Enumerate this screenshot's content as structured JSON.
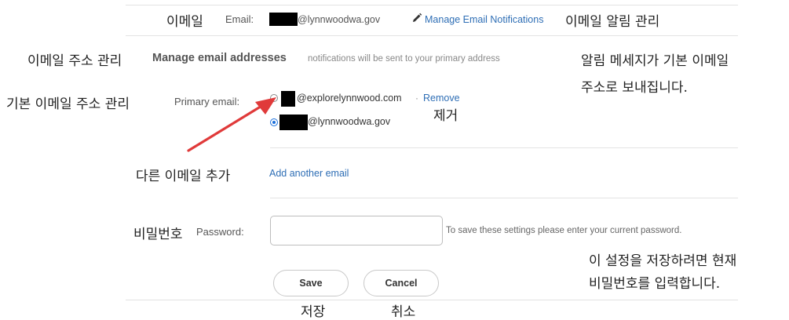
{
  "email_row": {
    "korean_label": "이메일",
    "label": "Email:",
    "value": "@lynnwoodwa.gov",
    "manage_link": "Manage Email Notifications",
    "manage_korean": "이메일 알림 관리"
  },
  "manage_section": {
    "korean_title": "이메일 주소 관리",
    "title": "Manage email addresses",
    "note": "notifications will be sent to your primary address",
    "note_korean_line1": "알림 메세지가 기본 이메일",
    "note_korean_line2": "주소로 보내집니다."
  },
  "primary": {
    "korean_label": "기본 이메일 주소 관리",
    "label": "Primary email:",
    "options": [
      {
        "email": "@explorelynnwood.com",
        "selected": false,
        "remove_label": "Remove",
        "separator": "·"
      },
      {
        "email": "@lynnwoodwa.gov",
        "selected": true
      }
    ],
    "remove_korean": "제거"
  },
  "add_email": {
    "korean_label": "다른 이메일 추가",
    "link": "Add another email"
  },
  "password": {
    "korean_label": "비밀번호",
    "label": "Password:",
    "value": "",
    "hint": "To save these settings please enter your current password.",
    "hint_korean_line1": "이 설정을 저장하려면 현재",
    "hint_korean_line2": "비밀번호를 입력합니다."
  },
  "buttons": {
    "save": "Save",
    "save_korean": "저장",
    "cancel": "Cancel",
    "cancel_korean": "취소"
  },
  "colors": {
    "link": "#2e6eb5",
    "annotation_arrow": "#e03a3a",
    "radio_selected": "#1a6fdb"
  },
  "icons": {
    "manage_link_icon": "pencil-icon",
    "annotation": "red-arrow"
  }
}
